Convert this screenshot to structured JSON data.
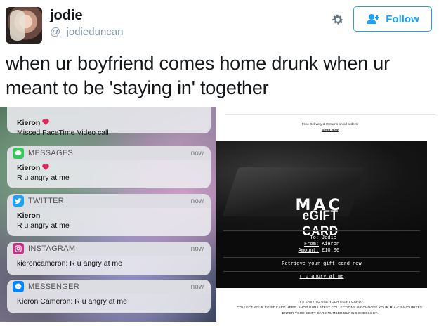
{
  "user": {
    "name": "jodie",
    "handle": "@_jodieduncan",
    "follow_label": "Follow"
  },
  "tweet": {
    "text": "when ur boyfriend comes home drunk when ur meant to be 'staying in' together"
  },
  "notifications": [
    {
      "app": "",
      "time": "",
      "from": "Kieron",
      "heart": true,
      "message": "Missed FaceTime Video call",
      "icon": "green-app-icon",
      "color": "#34c759"
    },
    {
      "app": "MESSAGES",
      "time": "now",
      "from": "Kieron",
      "heart": true,
      "message": "R u angry at me",
      "icon": "messages-icon",
      "color": "#34c759"
    },
    {
      "app": "TWITTER",
      "time": "now",
      "from": "Kieron",
      "heart": false,
      "message": "R u angry at me",
      "icon": "twitter-icon",
      "color": "#1da1f2"
    },
    {
      "app": "INSTAGRAM",
      "time": "now",
      "from": "",
      "heart": false,
      "message": "kieroncameron: R u angry at me",
      "icon": "instagram-icon",
      "color": "#c13584"
    },
    {
      "app": "MESSENGER",
      "time": "now",
      "from": "",
      "heart": false,
      "message": "Kieron Cameron: R u angry at me",
      "icon": "messenger-icon",
      "color": "#0084ff"
    }
  ],
  "email": {
    "faint_top": "",
    "promo_line": "Free Delivery & Returns on all orders.",
    "shop_now": "Shop Now",
    "brand": "MAC",
    "title": "eGIFT CARD",
    "to_label": "To:",
    "to_value": "Jodie",
    "from_label": "From:",
    "from_value": "Kieron",
    "amount_label": "Amount:",
    "amount_value": "£10.00",
    "retrieve_link": "Retrieve",
    "retrieve_rest": " your gift card now",
    "message": "r u angry at me",
    "footer_line1": "IT'S EASY TO USE YOUR EGIFT CARD.",
    "footer_line2": "COLLECT YOUR EGIFT CARD HERE. SHOP OUR LATEST COLLECTIONS OR CHOOSE YOUR M·A·C FAVOURITES.",
    "footer_line3": "ENTER YOUR EGIFT CARD NUMBER DURING CHECKOUT."
  },
  "colors": {
    "twitter_blue": "#1da1f2",
    "gift_bg": "#0b0b0b"
  }
}
